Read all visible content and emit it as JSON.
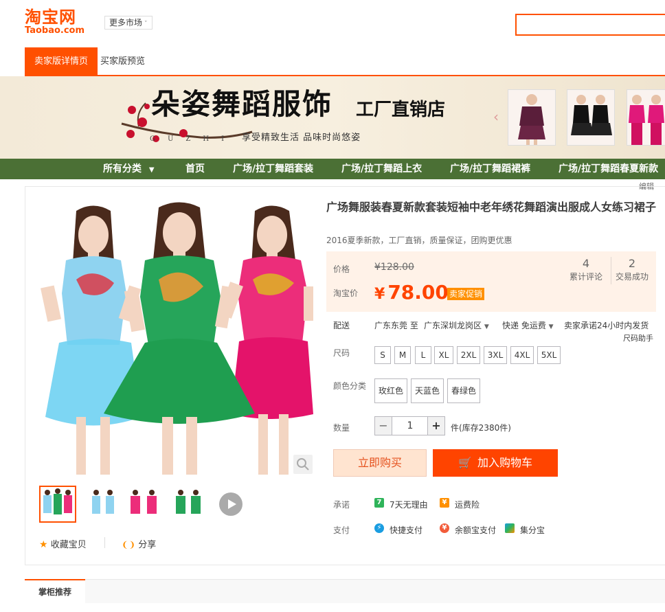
{
  "header": {
    "logo_cn": "淘宝网",
    "logo_en": "Taobao.com",
    "market_label": "更多市场",
    "search_placeholder": ""
  },
  "tabs": [
    {
      "label": "卖家版详情页",
      "active": true
    },
    {
      "label": "买家版预览",
      "active": false
    }
  ],
  "banner": {
    "shop_name": "朵姿舞蹈服饰",
    "shop_sub": "工厂直销店",
    "pinyin": "GUZHI",
    "slogan": "享受精致生活  品味时尚悠姿"
  },
  "nav": {
    "items": [
      "所有分类",
      "首页",
      "广场/拉丁舞蹈套装",
      "广场/拉丁舞蹈上衣",
      "广场/拉丁舞蹈裙裤",
      "广场/拉丁舞蹈春夏新款"
    ]
  },
  "edit_link": "编辑",
  "product": {
    "title": "广场舞服装春夏新款套装短袖中老年绣花舞蹈演出服成人女练习裙子",
    "subtitle": "2016夏季新款，工厂直销，质量保证，团购更优惠",
    "price_label": "价格",
    "original_price": "¥128.00",
    "taobao_price_label": "淘宝价",
    "yen": "¥",
    "current_price": "78.00",
    "promo_badge": "卖家促销",
    "stats": [
      {
        "value": "4",
        "label": "累计评论"
      },
      {
        "value": "2",
        "label": "交易成功"
      }
    ],
    "shipping": {
      "label": "配送",
      "from": "广东东莞 至",
      "to": "广东深圳龙岗区",
      "method": "快递 免运费",
      "promise": "卖家承诺24小时内发货"
    },
    "size_helper": "尺码助手",
    "size_label": "尺码",
    "sizes": [
      "S",
      "M",
      "L",
      "XL",
      "2XL",
      "3XL",
      "4XL",
      "5XL"
    ],
    "color_label": "颜色分类",
    "colors": [
      "玫红色",
      "天蓝色",
      "春绿色"
    ],
    "qty_label": "数量",
    "qty_minus": "−",
    "qty_value": "1",
    "qty_plus": "+",
    "stock_text": "件(库存2380件)",
    "buy_now": "立即购买",
    "add_cart": "加入购物车",
    "promise_label": "承诺",
    "promises": [
      "7天无理由",
      "运费险"
    ],
    "pay_label": "支付",
    "payments": [
      "快捷支付",
      "余额宝支付",
      "集分宝"
    ],
    "fav_label": "收藏宝贝",
    "share_label": "分享"
  },
  "bottom": {
    "tab_label": "掌柜推荐"
  },
  "colors": {
    "brand": "#ff5000",
    "nav_green": "#4b7035",
    "price": "#ff4400"
  }
}
